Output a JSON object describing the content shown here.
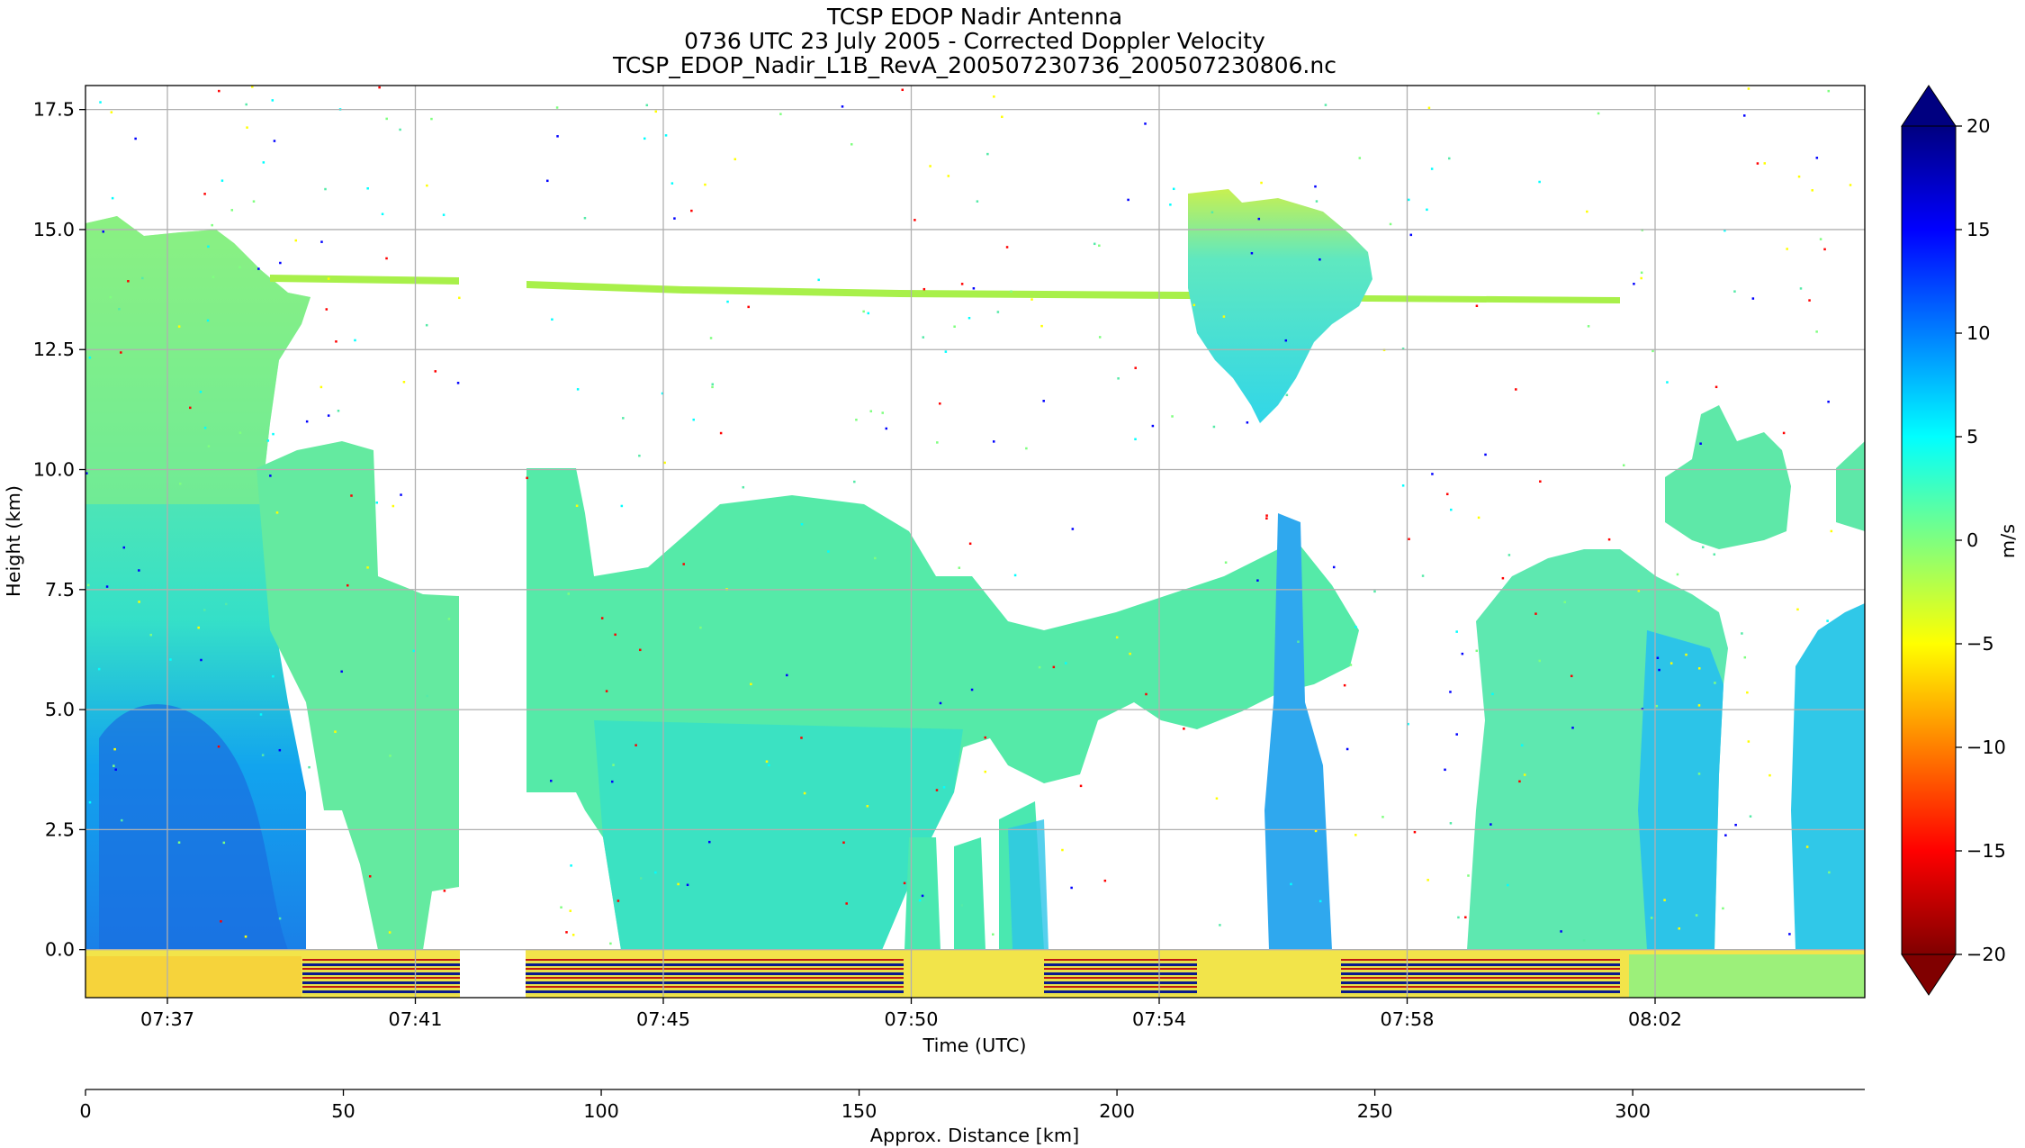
{
  "chart_data": {
    "type": "heatmap",
    "title_lines": [
      "TCSP EDOP Nadir Antenna",
      "0736 UTC 23 July 2005 - Corrected Doppler Velocity",
      "TCSP_EDOP_Nadir_L1B_RevA_200507230736_200507230806.nc"
    ],
    "xlabel": "Time (UTC)",
    "ylabel": "Height (km)",
    "x_tick_labels": [
      "07:37",
      "07:41",
      "07:45",
      "07:50",
      "07:54",
      "07:58",
      "08:02"
    ],
    "y_ticks": [
      0.0,
      2.5,
      5.0,
      7.5,
      10.0,
      12.5,
      15.0,
      17.5
    ],
    "y_tick_labels": [
      "0.0",
      "2.5",
      "5.0",
      "7.5",
      "10.0",
      "12.5",
      "15.0",
      "17.5"
    ],
    "ylim": [
      -1.0,
      18.0
    ],
    "grid": true,
    "colorbar": {
      "label": "m/s",
      "range": [
        -20,
        20
      ],
      "extend": "both",
      "colormap": "jet",
      "ticks": [
        -20,
        -15,
        -10,
        -5,
        0,
        5,
        10,
        15,
        20
      ],
      "tick_labels": [
        "−20",
        "−15",
        "−10",
        "−5",
        "0",
        "5",
        "10",
        "15",
        "20"
      ]
    },
    "secondary_x_axis": {
      "label": "Approx. Distance [km]",
      "ticks": [
        0,
        50,
        100,
        150,
        200,
        250,
        300
      ],
      "tick_labels": [
        "0",
        "50",
        "100",
        "150",
        "200",
        "250",
        "300"
      ],
      "range": [
        0,
        345
      ]
    },
    "features": [
      {
        "description": "deep convective core, strong upward velocities",
        "time_range": [
          "07:36",
          "07:40"
        ],
        "height_km": [
          0,
          15.2
        ],
        "velocity_ms": [
          3,
          12
        ]
      },
      {
        "description": "cirrus / anvil layer",
        "time_range": [
          "07:40",
          "07:59"
        ],
        "height_km": [
          13.5,
          14.0
        ],
        "velocity_ms": [
          -3,
          0
        ]
      },
      {
        "description": "data gap",
        "time_range": [
          "07:42",
          "07:43"
        ]
      },
      {
        "description": "isolated convective tower",
        "time_range": [
          "07:55",
          "07:57"
        ],
        "height_km": [
          10.8,
          15.8
        ],
        "velocity_ms": [
          0,
          6
        ]
      },
      {
        "description": "stratiform mid-level layer",
        "time_range": [
          "07:43",
          "07:58"
        ],
        "height_km": [
          3.5,
          10.0
        ],
        "velocity_ms": [
          0,
          3
        ]
      },
      {
        "description": "low-level convective cells",
        "time_range": [
          "07:59",
          "08:04"
        ],
        "height_km": [
          0,
          11.2
        ],
        "velocity_ms": [
          0,
          6
        ]
      }
    ]
  }
}
